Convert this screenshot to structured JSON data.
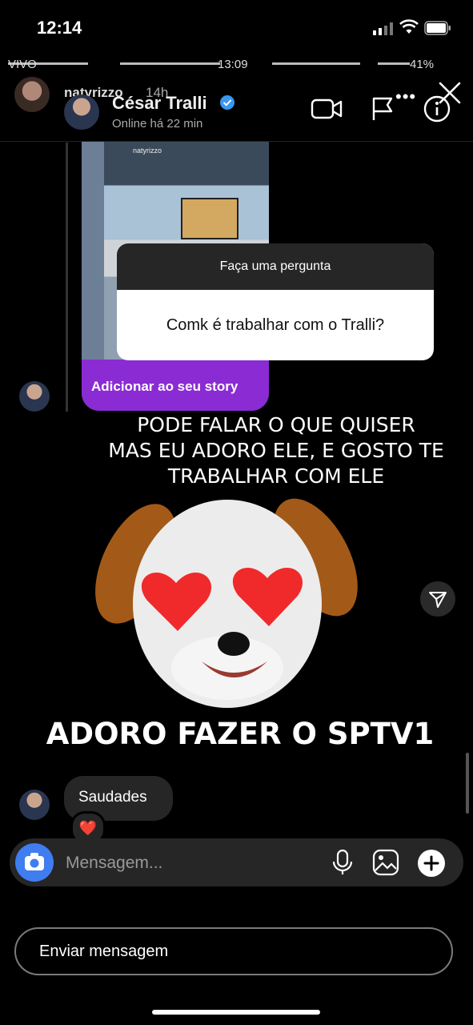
{
  "status_bar": {
    "time": "12:14"
  },
  "inner_status_bar": {
    "carrier": "VIVO",
    "time": "13:09",
    "battery": "41%"
  },
  "story": {
    "username": "natyrizzo",
    "age": "14h"
  },
  "dm_header": {
    "name": "César Tralli",
    "status": "Online há 22 min",
    "icons": [
      "video-camera-icon",
      "flag-icon",
      "info-icon"
    ]
  },
  "shared_story": {
    "thumb_username": "natyrizzo",
    "cta": "Adicionar ao seu story",
    "question_title": "Faça uma pergunta",
    "question_text": "Comk é trabalhar com o Tralli?"
  },
  "captions": {
    "line1": "PODE FALAR O QUE QUISER",
    "line2": "MAS EU ADORO ELE, E GOSTO TE",
    "line3": "TRABALHAR COM ELE",
    "bottom": "ADORO FAZER O SPTV1"
  },
  "message": {
    "text": "Saudades",
    "reaction": "❤️"
  },
  "composer": {
    "placeholder": "Mensagem..."
  },
  "send_button": {
    "label": "Enviar mensagem"
  },
  "colors": {
    "accent_purple": "#8a2bd4",
    "camera_blue": "#3f7df0",
    "verified_blue": "#3897f0"
  }
}
